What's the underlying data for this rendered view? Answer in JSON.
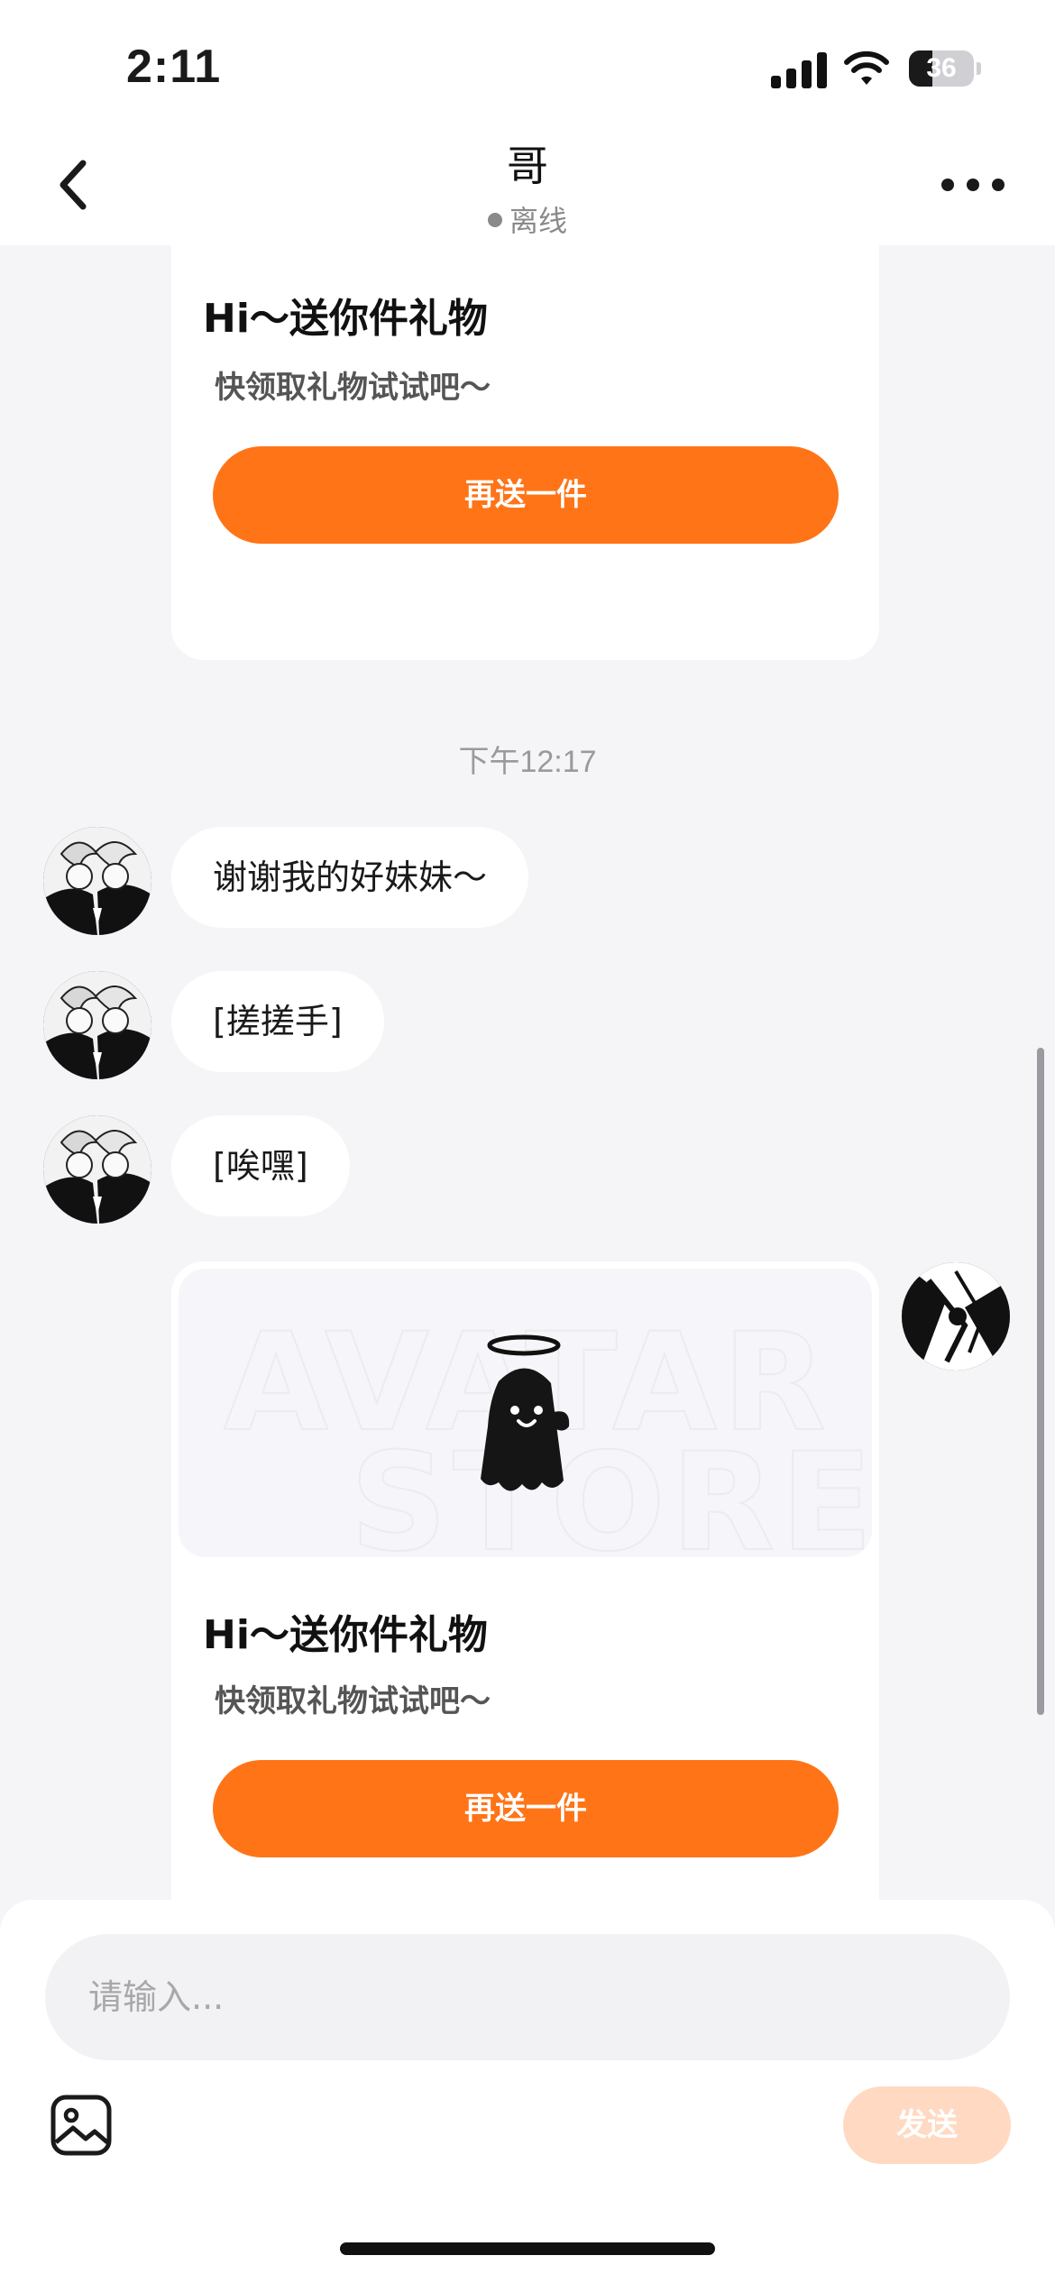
{
  "status_bar": {
    "time": "2:11",
    "battery": "36"
  },
  "nav": {
    "title": "哥",
    "status": "离线"
  },
  "gift_card_top": {
    "title": "Hi～送你件礼物",
    "subtitle": "快领取礼物试试吧～",
    "button": "再送一件"
  },
  "time_divider": "下午12:17",
  "messages": [
    {
      "text": "谢谢我的好妹妹～"
    },
    {
      "text": "[搓搓手]"
    },
    {
      "text": "[唉嘿]"
    }
  ],
  "gift_card_bottom": {
    "title": "Hi～送你件礼物",
    "subtitle": "快领取礼物试试吧～",
    "button": "再送一件"
  },
  "input": {
    "placeholder": "请输入..."
  },
  "send_button": "发送"
}
